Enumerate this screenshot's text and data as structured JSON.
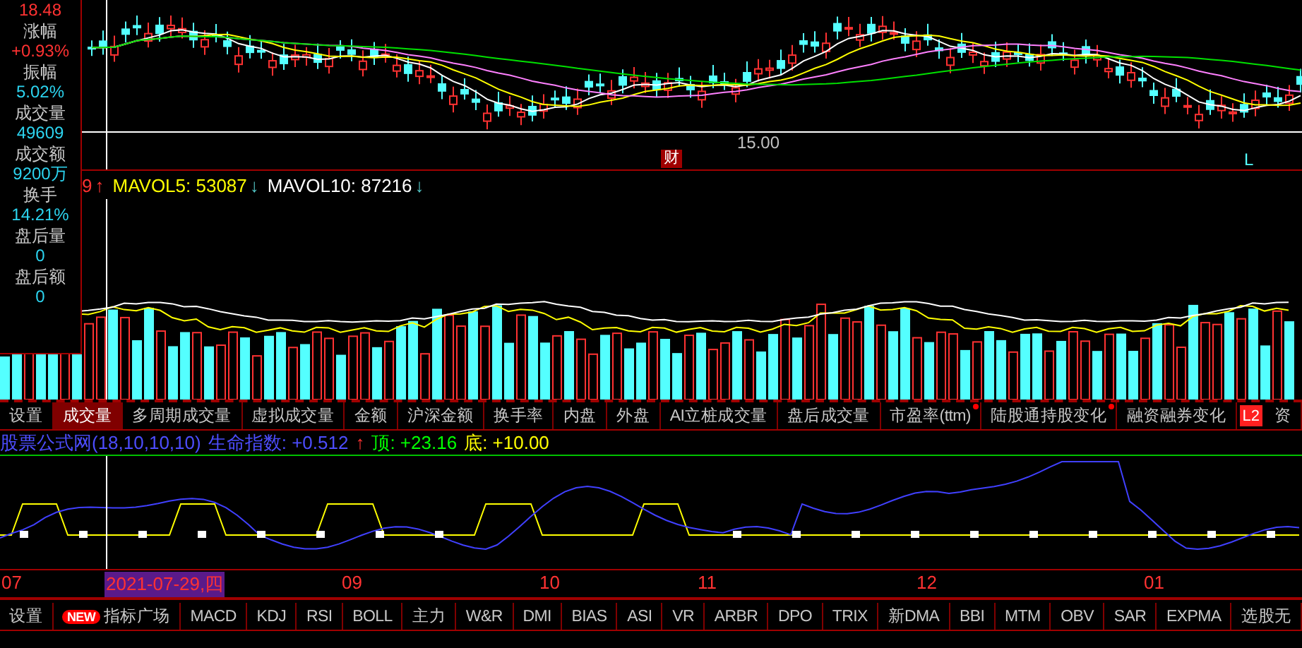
{
  "info_panel": {
    "price": "18.48",
    "fields": [
      {
        "label": "涨幅",
        "value": "+0.93%",
        "color": "#ff3232"
      },
      {
        "label": "振幅",
        "value": "5.02%",
        "color": "#2cd4f0"
      },
      {
        "label": "成交量",
        "value": "49609",
        "color": "#2cd4f0"
      },
      {
        "label": "成交额",
        "value": "9200万",
        "color": "#2cd4f0"
      },
      {
        "label": "换手",
        "value": "14.21%",
        "color": "#2cd4f0"
      },
      {
        "label": "盘后量",
        "value": "0",
        "color": "#2cd4f0"
      },
      {
        "label": "盘后额",
        "value": "0",
        "color": "#2cd4f0"
      }
    ]
  },
  "main_chart": {
    "low_label": "15.00",
    "event_marker": "财",
    "corner_label": "L"
  },
  "volume_header": {
    "lead": "9",
    "lead_arrow": "↑",
    "items": [
      {
        "label": "MAVOL5: 53087",
        "arrow": "↓",
        "color": "#ffff00"
      },
      {
        "label": "MAVOL10: 87216",
        "arrow": "↓",
        "color": "#ffffff"
      }
    ]
  },
  "volume_tabs": [
    {
      "label": "设置",
      "selected": false,
      "dot": false
    },
    {
      "label": "成交量",
      "selected": true,
      "dot": false
    },
    {
      "label": "多周期成交量",
      "selected": false,
      "dot": false
    },
    {
      "label": "虚拟成交量",
      "selected": false,
      "dot": false
    },
    {
      "label": "金额",
      "selected": false,
      "dot": false
    },
    {
      "label": "沪深金额",
      "selected": false,
      "dot": false
    },
    {
      "label": "换手率",
      "selected": false,
      "dot": false
    },
    {
      "label": "内盘",
      "selected": false,
      "dot": false
    },
    {
      "label": "外盘",
      "selected": false,
      "dot": false
    },
    {
      "label": "AI立桩成交量",
      "selected": false,
      "dot": false
    },
    {
      "label": "盘后成交量",
      "selected": false,
      "dot": false
    },
    {
      "label": "市盈率(ttm)",
      "selected": false,
      "dot": true
    },
    {
      "label": "陆股通持股变化",
      "selected": false,
      "dot": true
    },
    {
      "label": "融资融券变化",
      "selected": false,
      "dot": false
    },
    {
      "label": "资",
      "selected": false,
      "dot": false,
      "badge": "L2"
    }
  ],
  "indicator_header": {
    "name": "股票公式网(18,10,10,10)",
    "items": [
      {
        "label": "生命指数:",
        "value": "+0.512",
        "arrow": "↑",
        "color": "#4d4dff"
      },
      {
        "label": "顶:",
        "value": "+23.16",
        "color": "#00ff00"
      },
      {
        "label": "底:",
        "value": "+10.00",
        "color": "#ffff00"
      }
    ]
  },
  "date_axis": [
    {
      "label": "07",
      "selected": false
    },
    {
      "label": "2021-07-29,四",
      "selected": true
    },
    {
      "label": "09",
      "selected": false
    },
    {
      "label": "10",
      "selected": false
    },
    {
      "label": "11",
      "selected": false
    },
    {
      "label": "12",
      "selected": false
    },
    {
      "label": "01",
      "selected": false
    }
  ],
  "indicator_tabs": [
    {
      "label": "设置"
    },
    {
      "label": "指标广场",
      "badge": "NEW"
    },
    {
      "label": "MACD"
    },
    {
      "label": "KDJ"
    },
    {
      "label": "RSI"
    },
    {
      "label": "BOLL"
    },
    {
      "label": "主力"
    },
    {
      "label": "W&R"
    },
    {
      "label": "DMI"
    },
    {
      "label": "BIAS"
    },
    {
      "label": "ASI"
    },
    {
      "label": "VR"
    },
    {
      "label": "ARBR"
    },
    {
      "label": "DPO"
    },
    {
      "label": "TRIX"
    },
    {
      "label": "新DMA"
    },
    {
      "label": "BBI"
    },
    {
      "label": "MTM"
    },
    {
      "label": "OBV"
    },
    {
      "label": "SAR"
    },
    {
      "label": "EXPMA"
    },
    {
      "label": "选股无"
    }
  ]
}
